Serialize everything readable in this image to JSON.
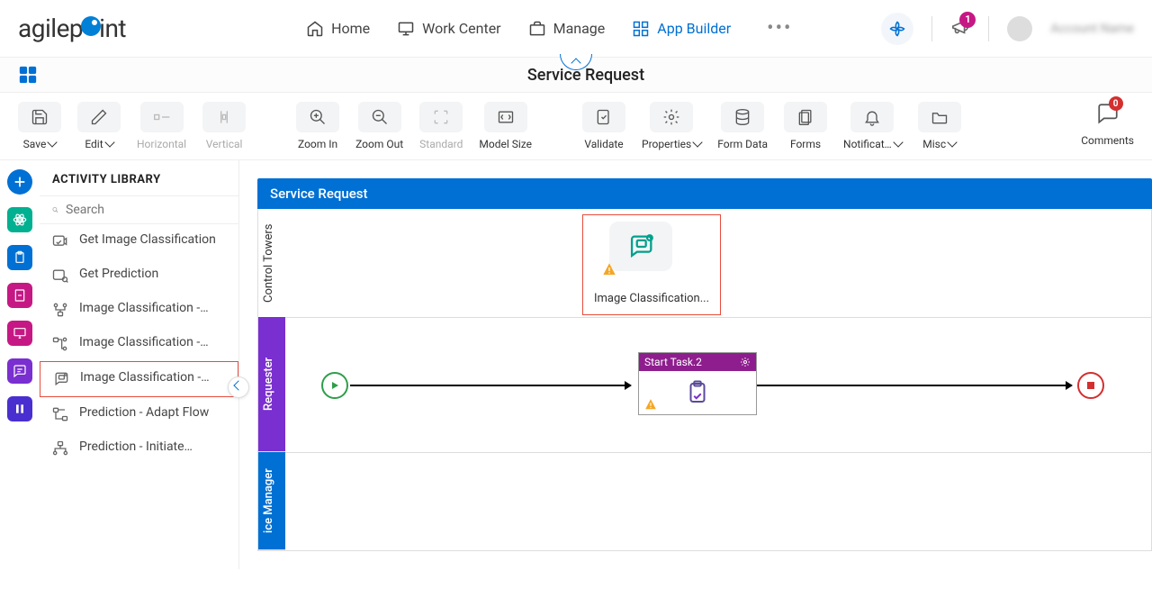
{
  "brand": {
    "pre": "agilep",
    "post": "int"
  },
  "nav": {
    "home": "Home",
    "workcenter": "Work Center",
    "manage": "Manage",
    "appbuilder": "App Builder"
  },
  "notifications_count": "1",
  "username": "Account Name",
  "page_title": "Service Request",
  "toolbar": {
    "save": "Save",
    "edit": "Edit",
    "horizontal": "Horizontal",
    "vertical": "Vertical",
    "zoomin": "Zoom In",
    "zoomout": "Zoom Out",
    "standard": "Standard",
    "modelsize": "Model Size",
    "validate": "Validate",
    "properties": "Properties",
    "formdata": "Form Data",
    "forms": "Forms",
    "notifications": "Notificat…",
    "misc": "Misc",
    "comments": "Comments",
    "comments_count": "0"
  },
  "sidebar": {
    "title": "ACTIVITY LIBRARY",
    "search_placeholder": "Search",
    "items": [
      "Get Image Classification",
      "Get Prediction",
      "Image Classification -…",
      "Image Classification -…",
      "Image Classification -…",
      "Prediction - Adapt Flow",
      "Prediction - Initiate…"
    ]
  },
  "canvas": {
    "header": "Service Request",
    "lanes": {
      "control": "Control Towers",
      "requester": "Requester",
      "manager": "ice Manager"
    },
    "activity_label": "Image Classification...",
    "task_label": "Start Task.2"
  }
}
